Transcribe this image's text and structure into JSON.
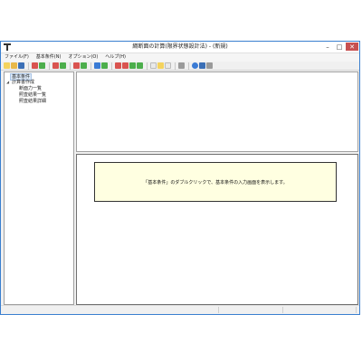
{
  "window": {
    "title": "綱断面の計算(限界状態設計法) - (新規)"
  },
  "menu": {
    "items": [
      {
        "label": "ファイル(F)"
      },
      {
        "label": "基本条件(N)"
      },
      {
        "label": "オプション(O)"
      },
      {
        "label": "ヘルプ(H)"
      }
    ]
  },
  "toolbar": {
    "colors": {
      "new": "#f4d35e",
      "open": "#e8b84a",
      "save": "#3b6fb6",
      "red": "#d9534f",
      "green": "#4cae4c",
      "blue": "#3a7bd5",
      "gray": "#9a9a9a",
      "doc": "#e9e9e9"
    }
  },
  "tree": {
    "root": "基本条件",
    "group": "計算書作成",
    "children": [
      {
        "label": "断面力一覧"
      },
      {
        "label": "照査結果一覧"
      },
      {
        "label": "照査結果詳細"
      }
    ]
  },
  "message": {
    "text": "「基本条件」のダブルクリックで、基本条件の入力画面を表示します。"
  },
  "statusbar": {
    "panes": [
      {
        "text": ""
      },
      {
        "text": ""
      },
      {
        "text": ""
      }
    ]
  }
}
